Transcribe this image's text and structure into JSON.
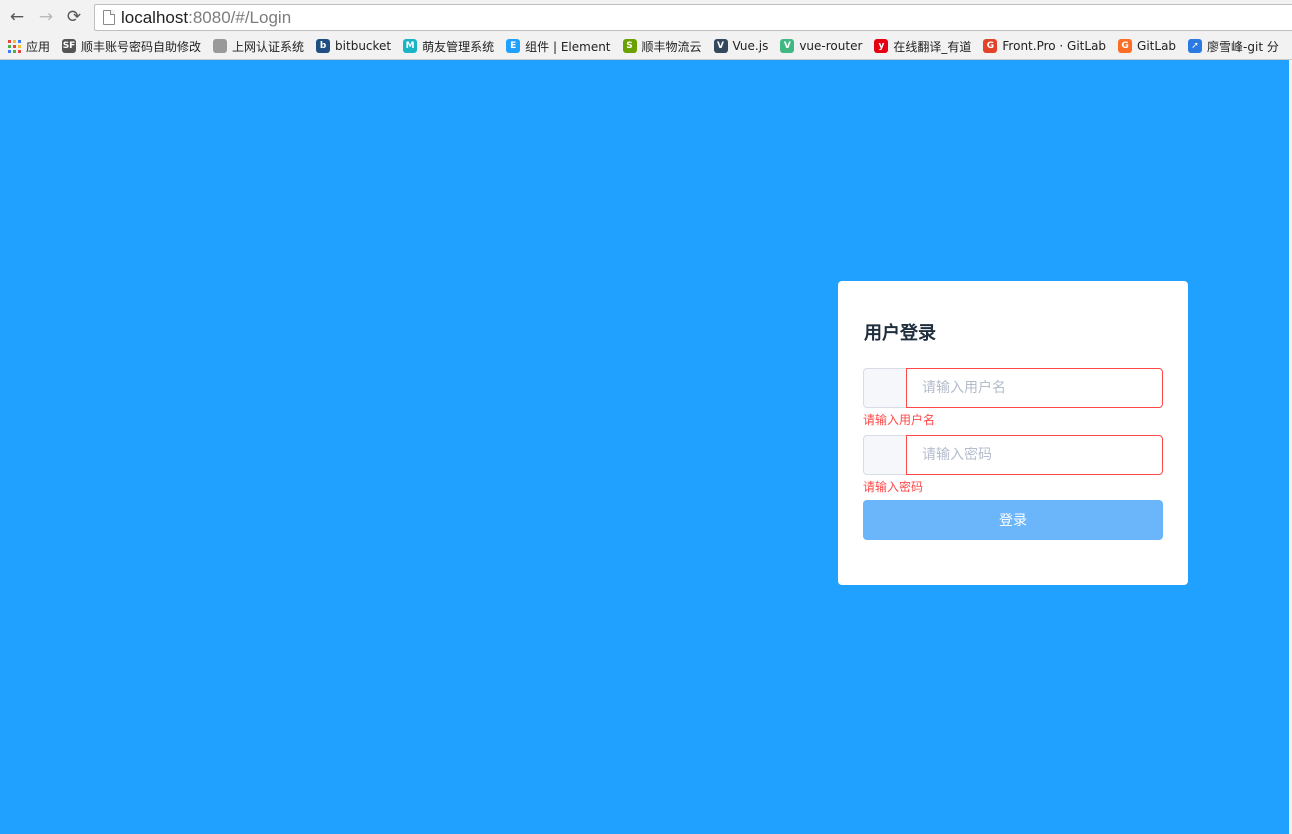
{
  "browser": {
    "url_host": "localhost",
    "url_rest": ":8080/#/Login",
    "back_glyph": "←",
    "forward_glyph": "→",
    "reload_glyph": "⟳",
    "bookmarks": [
      {
        "label": "应用",
        "icon": "apps-grid-icon"
      },
      {
        "label": "顺丰账号密码自助修改",
        "icon": "sf-logo-icon",
        "icon_text": "SF",
        "color": "#555555"
      },
      {
        "label": "上网认证系统",
        "icon": "page-icon",
        "icon_text": "",
        "color": "#999999"
      },
      {
        "label": "bitbucket",
        "icon": "bitbucket-icon",
        "icon_text": "b",
        "color": "#205081"
      },
      {
        "label": "萌友管理系统",
        "icon": "m-logo-icon",
        "icon_text": "M",
        "color": "#19b5c4"
      },
      {
        "label": "组件 | Element",
        "icon": "element-icon",
        "icon_text": "E",
        "color": "#20a0ff"
      },
      {
        "label": "顺丰物流云",
        "icon": "sf-cloud-icon",
        "icon_text": "S",
        "color": "#6aa100"
      },
      {
        "label": "Vue.js",
        "icon": "vue-icon",
        "icon_text": "V",
        "color": "#35495e"
      },
      {
        "label": "vue-router",
        "icon": "vue-icon",
        "icon_text": "V",
        "color": "#41b883"
      },
      {
        "label": "在线翻译_有道",
        "icon": "youdao-icon",
        "icon_text": "y",
        "color": "#e60012"
      },
      {
        "label": "Front.Pro · GitLab",
        "icon": "gitlab-icon",
        "icon_text": "G",
        "color": "#e24329"
      },
      {
        "label": "GitLab",
        "icon": "gitlab-icon",
        "icon_text": "G",
        "color": "#fc6d26"
      },
      {
        "label": "廖雪峰-git 分",
        "icon": "rocket-icon",
        "icon_text": "➚",
        "color": "#2a7ae2"
      }
    ]
  },
  "login": {
    "title": "用户登录",
    "username_placeholder": "请输入用户名",
    "username_error": "请输入用户名",
    "password_placeholder": "请输入密码",
    "password_error": "请输入密码",
    "submit_label": "登录"
  },
  "colors": {
    "page_background": "#20a0ff",
    "error": "#ff4949",
    "button": "#6bb6fb"
  }
}
